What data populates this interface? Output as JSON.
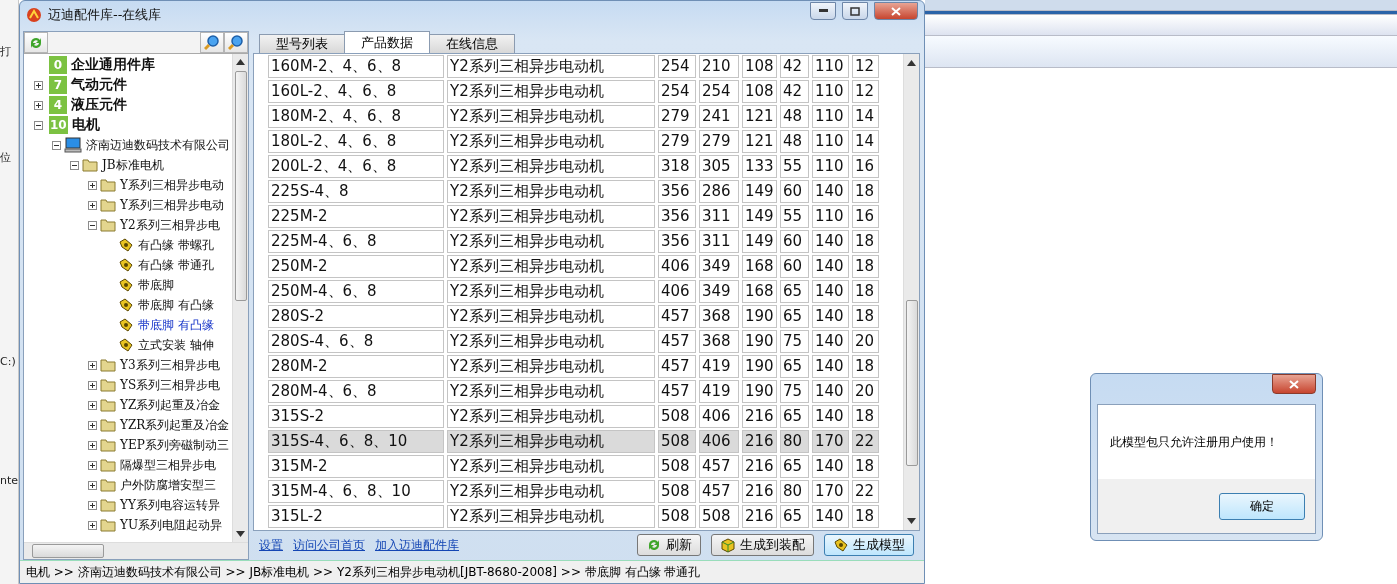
{
  "background_window": {
    "fragments": [
      "打",
      "位",
      "C:)",
      "nte"
    ]
  },
  "window": {
    "title": "迈迪配件库--在线库"
  },
  "tree": [
    {
      "label": "企业通用件库",
      "kind": "badge",
      "count": "0",
      "selected": false
    },
    {
      "label": "气动元件",
      "kind": "badge",
      "count": "7",
      "expanded": false,
      "selected": false
    },
    {
      "label": "液压元件",
      "kind": "badge",
      "count": "4",
      "expanded": false,
      "selected": false
    },
    {
      "label": "电机",
      "kind": "badge",
      "count": "10",
      "expanded": true,
      "selected": false,
      "children": [
        {
          "label": "济南迈迪数码技术有限公司",
          "kind": "computer",
          "expanded": true,
          "selected": false,
          "children": [
            {
              "label": "JB标准电机",
              "kind": "folder",
              "expanded": true,
              "selected": false,
              "children": [
                {
                  "label": "Y系列三相异步电动",
                  "kind": "folder",
                  "expanded": false,
                  "selected": false
                },
                {
                  "label": "Y系列三相异步电动",
                  "kind": "folder",
                  "expanded": false,
                  "selected": false
                },
                {
                  "label": "Y2系列三相异步电",
                  "kind": "folder",
                  "expanded": true,
                  "selected": false,
                  "children": [
                    {
                      "label": "有凸缘 带螺孔",
                      "kind": "part",
                      "selected": false
                    },
                    {
                      "label": "有凸缘 带通孔",
                      "kind": "part",
                      "selected": false
                    },
                    {
                      "label": "带底脚",
                      "kind": "part",
                      "selected": false
                    },
                    {
                      "label": "带底脚 有凸缘",
                      "kind": "part",
                      "selected": false
                    },
                    {
                      "label": "带底脚 有凸缘",
                      "kind": "part",
                      "selected": true
                    },
                    {
                      "label": "立式安装 轴伸",
                      "kind": "part",
                      "selected": false
                    }
                  ]
                },
                {
                  "label": "Y3系列三相异步电",
                  "kind": "folder",
                  "expanded": false,
                  "selected": false
                },
                {
                  "label": "YS系列三相异步电",
                  "kind": "folder",
                  "expanded": false,
                  "selected": false
                },
                {
                  "label": "YZ系列起重及冶金",
                  "kind": "folder",
                  "expanded": false,
                  "selected": false
                },
                {
                  "label": "YZR系列起重及冶金",
                  "kind": "folder",
                  "expanded": false,
                  "selected": false
                },
                {
                  "label": "YEP系列旁磁制动三",
                  "kind": "folder",
                  "expanded": false,
                  "selected": false
                },
                {
                  "label": "隔爆型三相异步电",
                  "kind": "folder",
                  "expanded": false,
                  "selected": false
                },
                {
                  "label": "户外防腐增安型三",
                  "kind": "folder",
                  "expanded": false,
                  "selected": false
                },
                {
                  "label": "YY系列电容运转异",
                  "kind": "folder",
                  "expanded": false,
                  "selected": false
                },
                {
                  "label": "YU系列电阻起动异",
                  "kind": "folder",
                  "expanded": false,
                  "selected": false
                }
              ]
            }
          ]
        }
      ]
    }
  ],
  "tabs": [
    {
      "label": "型号列表",
      "selected": false
    },
    {
      "label": "产品数据",
      "selected": true
    },
    {
      "label": "在线信息",
      "selected": false
    }
  ],
  "table": {
    "rows": [
      {
        "selected": false,
        "cells": [
          "160M-2、4、6、8",
          "Y2系列三相异步电动机",
          "254",
          "210",
          "108",
          "42",
          "110",
          "12"
        ]
      },
      {
        "selected": false,
        "cells": [
          "160L-2、4、6、8",
          "Y2系列三相异步电动机",
          "254",
          "254",
          "108",
          "42",
          "110",
          "12"
        ]
      },
      {
        "selected": false,
        "cells": [
          "180M-2、4、6、8",
          "Y2系列三相异步电动机",
          "279",
          "241",
          "121",
          "48",
          "110",
          "14"
        ]
      },
      {
        "selected": false,
        "cells": [
          "180L-2、4、6、8",
          "Y2系列三相异步电动机",
          "279",
          "279",
          "121",
          "48",
          "110",
          "14"
        ]
      },
      {
        "selected": false,
        "cells": [
          "200L-2、4、6、8",
          "Y2系列三相异步电动机",
          "318",
          "305",
          "133",
          "55",
          "110",
          "16"
        ]
      },
      {
        "selected": false,
        "cells": [
          "225S-4、8",
          "Y2系列三相异步电动机",
          "356",
          "286",
          "149",
          "60",
          "140",
          "18"
        ]
      },
      {
        "selected": false,
        "cells": [
          "225M-2",
          "Y2系列三相异步电动机",
          "356",
          "311",
          "149",
          "55",
          "110",
          "16"
        ]
      },
      {
        "selected": false,
        "cells": [
          "225M-4、6、8",
          "Y2系列三相异步电动机",
          "356",
          "311",
          "149",
          "60",
          "140",
          "18"
        ]
      },
      {
        "selected": false,
        "cells": [
          "250M-2",
          "Y2系列三相异步电动机",
          "406",
          "349",
          "168",
          "60",
          "140",
          "18"
        ]
      },
      {
        "selected": false,
        "cells": [
          "250M-4、6、8",
          "Y2系列三相异步电动机",
          "406",
          "349",
          "168",
          "65",
          "140",
          "18"
        ]
      },
      {
        "selected": false,
        "cells": [
          "280S-2",
          "Y2系列三相异步电动机",
          "457",
          "368",
          "190",
          "65",
          "140",
          "18"
        ]
      },
      {
        "selected": false,
        "cells": [
          "280S-4、6、8",
          "Y2系列三相异步电动机",
          "457",
          "368",
          "190",
          "75",
          "140",
          "20"
        ]
      },
      {
        "selected": false,
        "cells": [
          "280M-2",
          "Y2系列三相异步电动机",
          "457",
          "419",
          "190",
          "65",
          "140",
          "18"
        ]
      },
      {
        "selected": false,
        "cells": [
          "280M-4、6、8",
          "Y2系列三相异步电动机",
          "457",
          "419",
          "190",
          "75",
          "140",
          "20"
        ]
      },
      {
        "selected": false,
        "cells": [
          "315S-2",
          "Y2系列三相异步电动机",
          "508",
          "406",
          "216",
          "65",
          "140",
          "18"
        ]
      },
      {
        "selected": true,
        "cells": [
          "315S-4、6、8、10",
          "Y2系列三相异步电动机",
          "508",
          "406",
          "216",
          "80",
          "170",
          "22"
        ]
      },
      {
        "selected": false,
        "cells": [
          "315M-2",
          "Y2系列三相异步电动机",
          "508",
          "457",
          "216",
          "65",
          "140",
          "18"
        ]
      },
      {
        "selected": false,
        "cells": [
          "315M-4、6、8、10",
          "Y2系列三相异步电动机",
          "508",
          "457",
          "216",
          "80",
          "170",
          "22"
        ]
      },
      {
        "selected": false,
        "cells": [
          "315L-2",
          "Y2系列三相异步电动机",
          "508",
          "508",
          "216",
          "65",
          "140",
          "18"
        ]
      }
    ]
  },
  "links": [
    "设置",
    "访问公司首页",
    "加入迈迪配件库"
  ],
  "buttons": [
    {
      "label": "刷新",
      "kind": "refresh",
      "focused": false
    },
    {
      "label": "生成到装配",
      "kind": "assembly",
      "focused": false
    },
    {
      "label": "生成模型",
      "kind": "model",
      "focused": true
    }
  ],
  "status_bar": "电机 >> 济南迈迪数码技术有限公司 >> JB标准电机 >> Y2系列三相异步电动机[JBT-8680-2008] >> 带底脚 有凸缘 带通孔",
  "dialog": {
    "message": "此模型包只允许注册用户使用！",
    "button": "确定"
  }
}
